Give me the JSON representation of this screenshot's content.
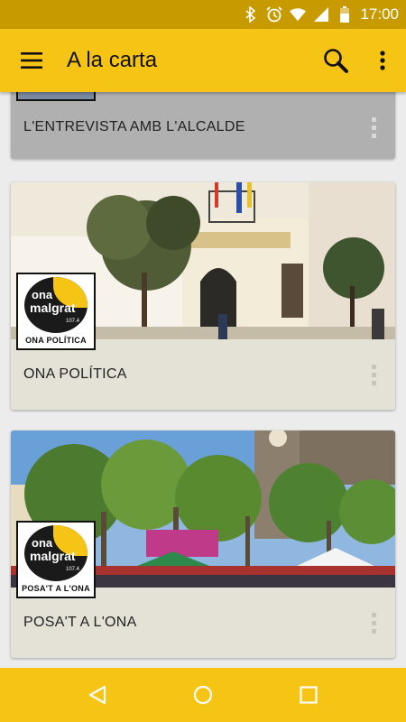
{
  "status_bar": {
    "time": "17:00",
    "icons": [
      "bluetooth-icon",
      "alarm-icon",
      "wifi-icon",
      "signal-icon",
      "battery-icon"
    ]
  },
  "app_bar": {
    "title": "A la carta",
    "icons": [
      "menu-icon",
      "search-icon",
      "more-vert-icon"
    ]
  },
  "programs": [
    {
      "title": "L'ENTREVISTA AMB L'ALCALDE"
    },
    {
      "title": "ONA POLÍTICA",
      "logo": {
        "brand_line1": "ona",
        "brand_line2": "malgrat",
        "frequency": "107.4",
        "program": "ONA POLÍTICA"
      }
    },
    {
      "title": "POSA'T A L'ONA",
      "logo": {
        "brand_line1": "ona",
        "brand_line2": "malgrat",
        "frequency": "107.4",
        "program": "POSA'T A L'ONA"
      }
    }
  ],
  "nav_bar": {
    "icons": [
      "back-icon",
      "home-icon",
      "recents-icon"
    ]
  },
  "colors": {
    "accent": "#f5c414",
    "status_bar": "#c79b00",
    "card": "#e4e2d6"
  }
}
